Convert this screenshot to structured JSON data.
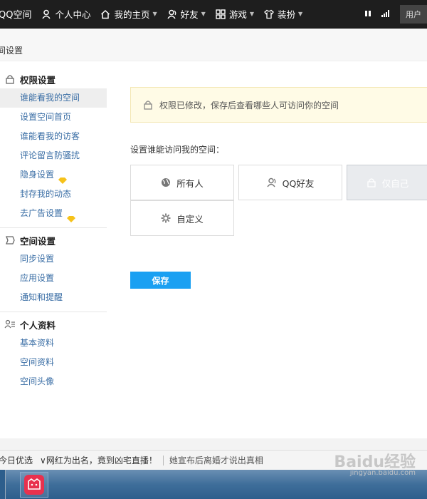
{
  "topnav": {
    "brand": "QQ空间",
    "items": [
      {
        "label": "个人中心",
        "icon": "user-icon",
        "dropdown": false
      },
      {
        "label": "我的主页",
        "icon": "home-icon",
        "dropdown": true
      },
      {
        "label": "好友",
        "icon": "friends-icon",
        "dropdown": true
      },
      {
        "label": "游戏",
        "icon": "grid-icon",
        "dropdown": true
      },
      {
        "label": "装扮",
        "icon": "shirt-icon",
        "dropdown": true
      }
    ],
    "user_label": "用户"
  },
  "page": {
    "title": "间设置"
  },
  "sidebar": {
    "groups": [
      {
        "title": "权限设置",
        "icon": "lock-icon",
        "items": [
          {
            "label": "谁能看我的空间",
            "active": true,
            "gem": false
          },
          {
            "label": "设置空间首页",
            "active": false,
            "gem": false
          },
          {
            "label": "谁能看我的访客",
            "active": false,
            "gem": false
          },
          {
            "label": "评论留言防骚扰",
            "active": false,
            "gem": false
          },
          {
            "label": "隐身设置",
            "active": false,
            "gem": true
          },
          {
            "label": "封存我的动态",
            "active": false,
            "gem": false
          },
          {
            "label": "去广告设置",
            "active": false,
            "gem": true
          }
        ]
      },
      {
        "title": "空间设置",
        "icon": "space-icon",
        "items": [
          {
            "label": "同步设置"
          },
          {
            "label": "应用设置"
          },
          {
            "label": "通知和提醒"
          }
        ]
      },
      {
        "title": "个人资料",
        "icon": "profile-icon",
        "items": [
          {
            "label": "基本资料"
          },
          {
            "label": "空间资料"
          },
          {
            "label": "空间头像"
          }
        ]
      }
    ]
  },
  "content": {
    "notice": "权限已修改，保存后查看哪些人可访问你的空间",
    "set_label": "设置谁能访问我的空间：",
    "options": [
      {
        "label": "所有人",
        "icon": "globe-icon",
        "selected": false
      },
      {
        "label": "QQ好友",
        "icon": "friend-icon",
        "selected": false
      },
      {
        "label": "仅自己",
        "icon": "lock-icon",
        "selected": true
      },
      {
        "label": "自定义",
        "icon": "gear-icon",
        "selected": false
      }
    ],
    "save_label": "保存"
  },
  "ticker": {
    "item1": "今日优选",
    "item2": "网红为出名，竟到凶宅直播！",
    "item3": "她宣布后离婚才说出真相"
  },
  "watermark": {
    "brand": "Baidu经验",
    "url": "jingyan.baidu.com"
  },
  "colors": {
    "accent": "#1aa0f2",
    "link": "#3a6ea5",
    "notice_bg": "#fffbe6"
  }
}
